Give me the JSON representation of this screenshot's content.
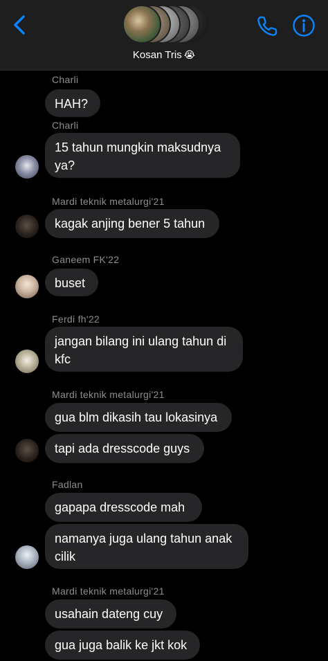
{
  "header": {
    "title": "Kosan Tris",
    "title_emoji": "😭",
    "back_icon": "chevron-left-icon",
    "call_icon": "phone-icon",
    "info_icon": "info-icon",
    "accent_color": "#0a84ff"
  },
  "messages": [
    {
      "sender": "Charli",
      "text": "HAH?"
    },
    {
      "sender": "Charli",
      "text": "15 tahun mungkin maksudnya ya?"
    },
    {
      "sender": "Mardi teknik metalurgi'21",
      "text": "kagak anjing bener 5 tahun"
    },
    {
      "sender": "Ganeem FK'22",
      "text": "buset"
    },
    {
      "sender": "Ferdi fh'22",
      "text": "jangan bilang ini ulang tahun di kfc"
    },
    {
      "sender": "Mardi teknik metalurgi'21",
      "text": "gua blm dikasih tau lokasinya"
    },
    {
      "text": "tapi ada dresscode guys"
    },
    {
      "sender": "Fadlan",
      "text": "gapapa dresscode mah"
    },
    {
      "text": "namanya juga ulang tahun anak cilik"
    },
    {
      "sender": "Mardi teknik metalurgi'21",
      "text": "usahain dateng cuy"
    },
    {
      "text": "gua juga balik ke jkt kok"
    }
  ]
}
